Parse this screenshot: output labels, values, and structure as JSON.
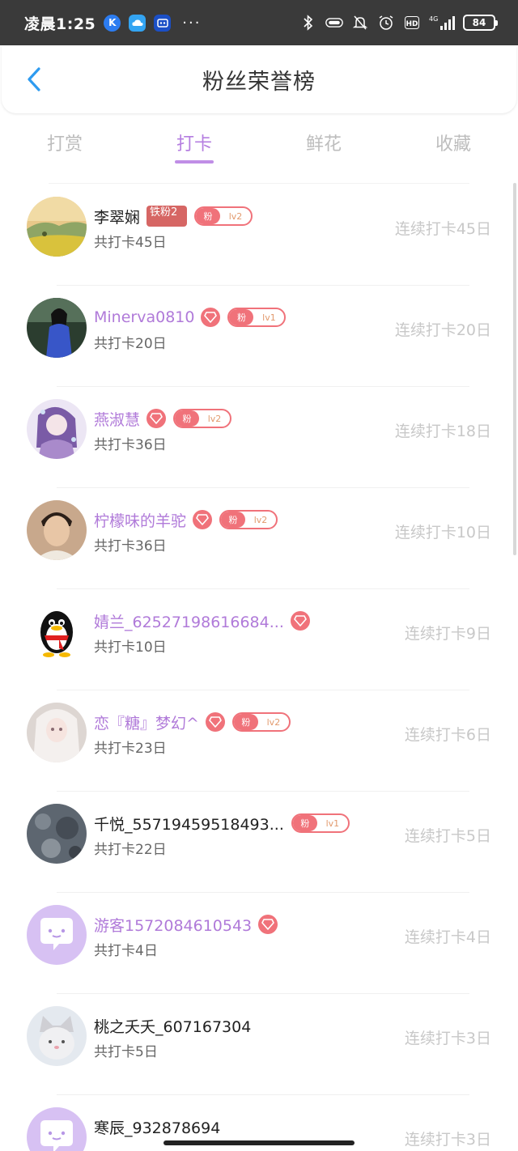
{
  "statusbar": {
    "time": "凌晨1:25",
    "dots": "···",
    "network": "4G",
    "battery": "84",
    "app_icons": [
      {
        "icon": "k-app-icon",
        "label": "K",
        "color": "#2c7cf0"
      },
      {
        "icon": "cloud-app-icon",
        "label": "",
        "color": "#33a4f2"
      },
      {
        "icon": "robot-app-icon",
        "label": "",
        "color": "#1b4fc6"
      }
    ]
  },
  "header": {
    "title": "粉丝荣誉榜",
    "back_icon": "chevron-left-icon"
  },
  "tabs": [
    {
      "label": "打赏",
      "active": false
    },
    {
      "label": "打卡",
      "active": true
    },
    {
      "label": "鲜花",
      "active": false
    },
    {
      "label": "收藏",
      "active": false
    }
  ],
  "colors": {
    "accent": "#b57ee0",
    "badge": "#f0727a",
    "muted": "#c8c8c8"
  },
  "rows": [
    {
      "name": "李翠娴",
      "vip": false,
      "gem": false,
      "iron": "铁粉2",
      "fan": {
        "tag": "粉",
        "level": "lv2"
      },
      "total": "共打卡45日",
      "streak": "连续打卡45日",
      "avatar": "landscape"
    },
    {
      "name": "Minerva0810",
      "vip": true,
      "gem": true,
      "iron": null,
      "fan": {
        "tag": "粉",
        "level": "lv1"
      },
      "total": "共打卡20日",
      "streak": "连续打卡20日",
      "avatar": "woman-blue"
    },
    {
      "name": "燕淑慧",
      "vip": true,
      "gem": true,
      "iron": null,
      "fan": {
        "tag": "粉",
        "level": "lv2"
      },
      "total": "共打卡36日",
      "streak": "连续打卡18日",
      "avatar": "anime-girl"
    },
    {
      "name": "柠檬味的羊驼",
      "vip": true,
      "gem": true,
      "iron": null,
      "fan": {
        "tag": "粉",
        "level": "lv2"
      },
      "total": "共打卡36日",
      "streak": "连续打卡10日",
      "avatar": "man-portrait"
    },
    {
      "name": "婧兰_62527198616684...",
      "vip": true,
      "gem": true,
      "iron": null,
      "fan": null,
      "total": "共打卡10日",
      "streak": "连续打卡9日",
      "avatar": "penguin"
    },
    {
      "name": "恋『糖』梦幻^",
      "vip": true,
      "gem": true,
      "iron": null,
      "fan": {
        "tag": "粉",
        "level": "lv2"
      },
      "total": "共打卡23日",
      "streak": "连续打卡6日",
      "avatar": "white-hair-girl"
    },
    {
      "name": "千悦_55719459518493...",
      "vip": false,
      "gem": false,
      "iron": null,
      "fan": {
        "tag": "粉",
        "level": "lv1"
      },
      "total": "共打卡22日",
      "streak": "连续打卡5日",
      "avatar": "granite"
    },
    {
      "name": "游客1572084610543",
      "vip": true,
      "gem": true,
      "iron": null,
      "fan": null,
      "total": "共打卡4日",
      "streak": "连续打卡4日",
      "avatar": "chat-bubble"
    },
    {
      "name": "桃之夭夭_607167304",
      "vip": false,
      "gem": false,
      "iron": null,
      "fan": null,
      "total": "共打卡5日",
      "streak": "连续打卡3日",
      "avatar": "cat"
    },
    {
      "name": "寒辰_932878694",
      "vip": false,
      "gem": false,
      "iron": null,
      "fan": null,
      "total": "",
      "streak": "连续打卡3日",
      "avatar": "chat-bubble"
    }
  ]
}
